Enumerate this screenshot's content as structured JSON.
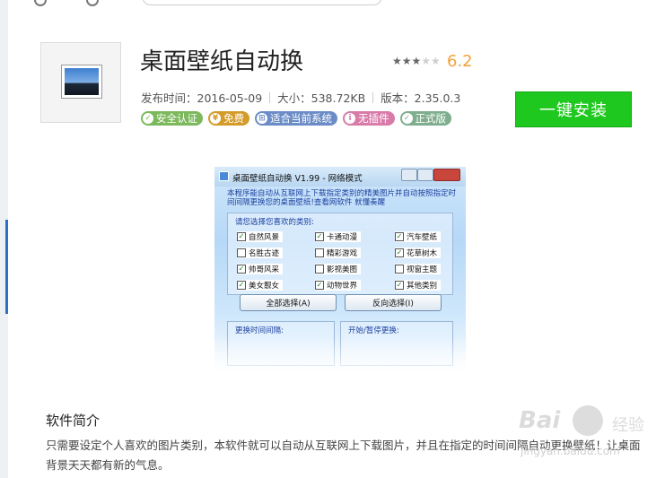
{
  "app": {
    "title": "桌面壁纸自动换",
    "rating": "6.2",
    "stars": {
      "filled": 3,
      "total": 5
    },
    "meta": {
      "publish": "发布时间：2016-05-09",
      "size": "大小：538.72KB",
      "version": "版本：2.35.0.3"
    },
    "badges": [
      {
        "label": "安全认证",
        "color": "#7cb95c",
        "icon": "shield-icon",
        "glyph": "✓"
      },
      {
        "label": "免费",
        "color": "#d39b2a",
        "icon": "coin-icon",
        "glyph": "¥"
      },
      {
        "label": "适合当前系统",
        "color": "#6b8cc7",
        "icon": "windows-icon",
        "glyph": "⊞"
      },
      {
        "label": "无插件",
        "color": "#d97ba8",
        "icon": "info-icon",
        "glyph": "i"
      },
      {
        "label": "正式版",
        "color": "#7fae8f",
        "icon": "check-icon",
        "glyph": "✓"
      }
    ],
    "install_label": "一键安装"
  },
  "screenshot": {
    "window_title": "桌面壁纸自动换 V1.99 - 网络模式",
    "notice": "本程序能自动从互联网上下载指定类别的精美图片并自动按照指定时间间隔更换您的桌面壁纸!查看网软件 就懂奏醒",
    "categories_label": "请您选择您喜欢的类别:",
    "categories": [
      {
        "label": "自然风景",
        "checked": true
      },
      {
        "label": "卡通动漫",
        "checked": true
      },
      {
        "label": "汽车壁纸",
        "checked": true
      },
      {
        "label": "名胜古迹",
        "checked": false
      },
      {
        "label": "精彩游戏",
        "checked": false
      },
      {
        "label": "花草树木",
        "checked": true
      },
      {
        "label": "帅哥风采",
        "checked": true
      },
      {
        "label": "影视美图",
        "checked": false
      },
      {
        "label": "视窗主题",
        "checked": false
      },
      {
        "label": "美女靓女",
        "checked": true
      },
      {
        "label": "动物世界",
        "checked": true
      },
      {
        "label": "其他类别",
        "checked": true
      }
    ],
    "select_all": "全部选择(A)",
    "invert_select": "反向选择(I)",
    "interval_label": "更换时间间隔:",
    "toggle_label": "开始/暂停更换:"
  },
  "intro": {
    "title": "软件简介",
    "text": "只需要设定个人喜欢的图片类别，本软件就可以自动从互联网上下载图片，并且在指定的时间间隔自动更换壁纸！让桌面背景天天都有新的气息。"
  },
  "watermark": {
    "brand": "Bai",
    "suffix": "经验",
    "url": "jingyan.baidu.com"
  }
}
